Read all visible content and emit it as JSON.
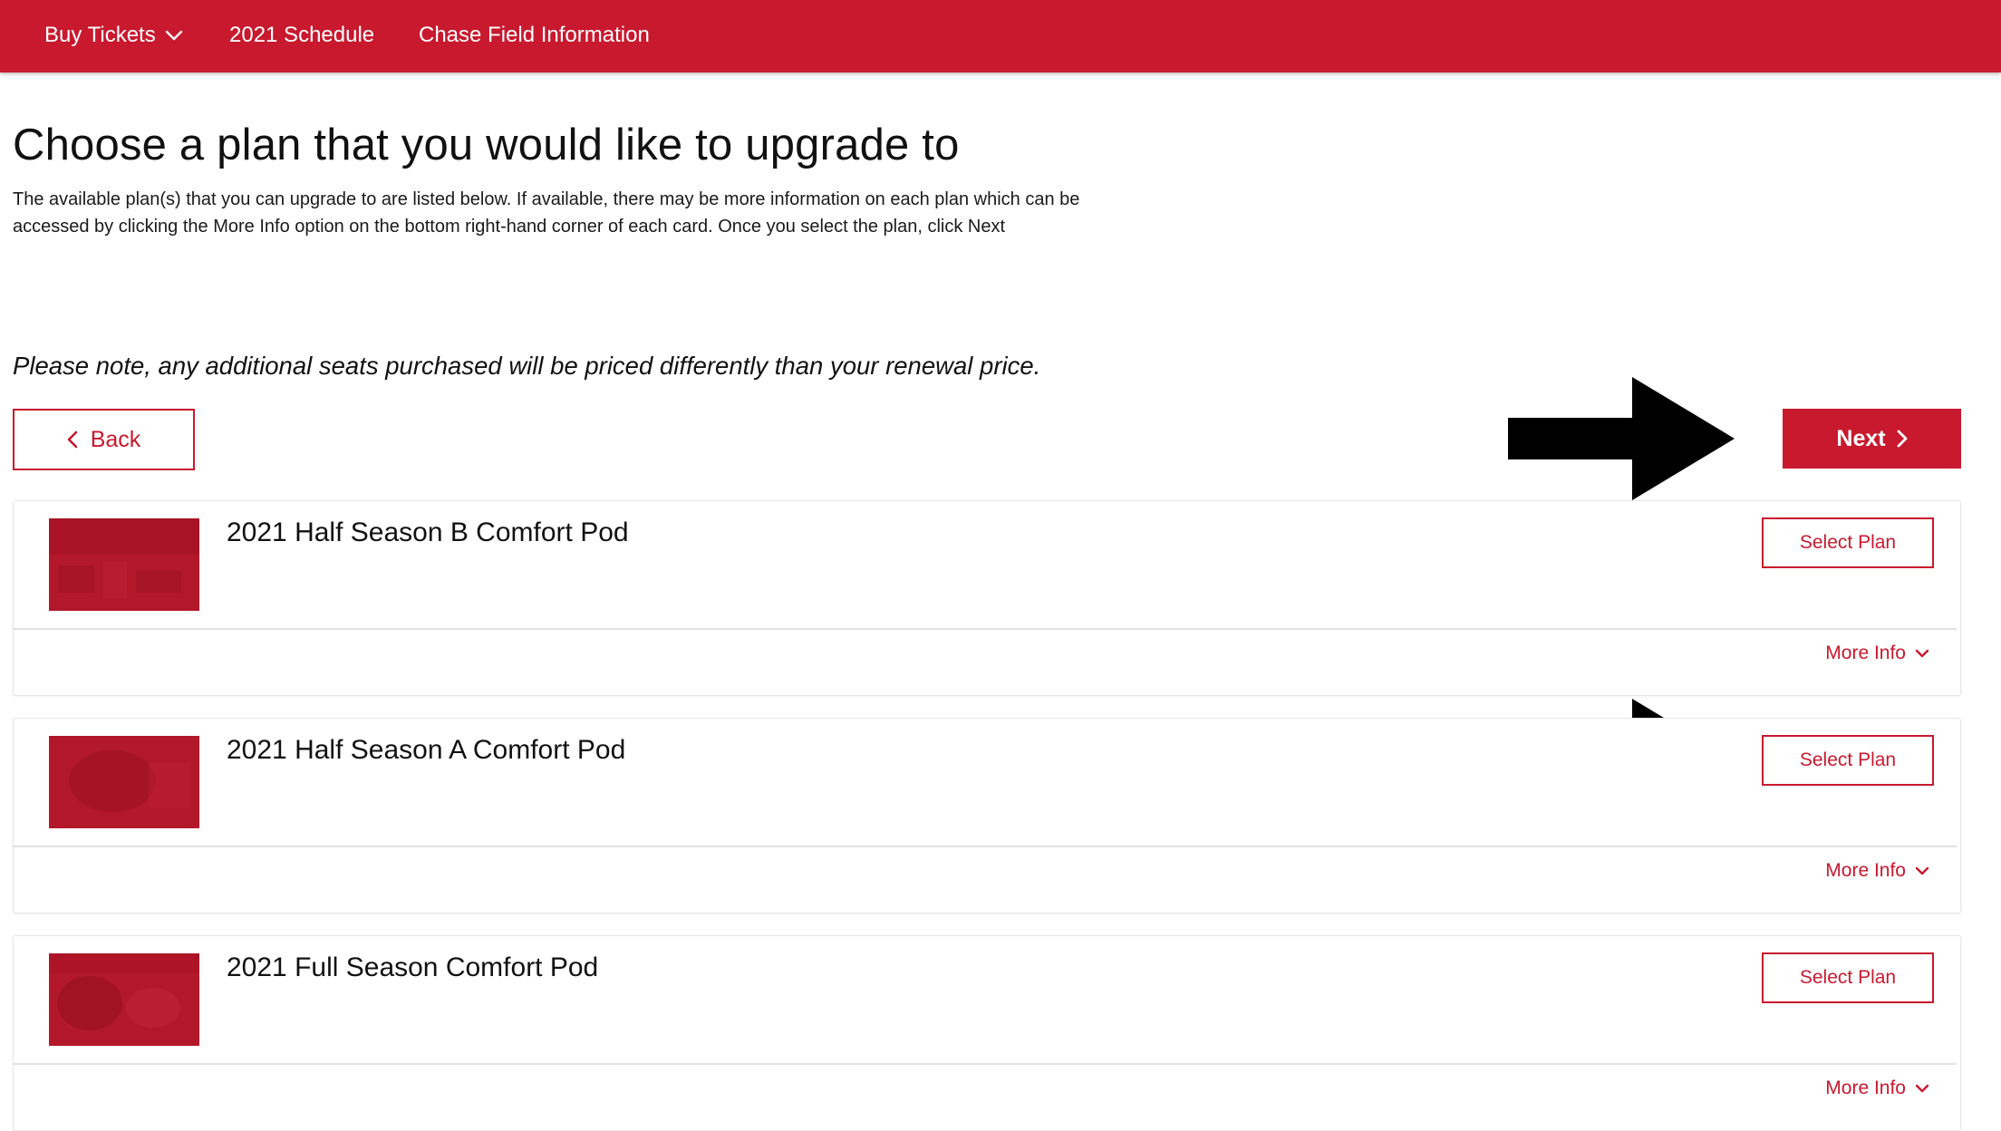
{
  "nav": {
    "items": [
      {
        "label": "Buy Tickets",
        "has_dropdown": true
      },
      {
        "label": "2021 Schedule",
        "has_dropdown": false
      },
      {
        "label": "Chase Field Information",
        "has_dropdown": false
      }
    ]
  },
  "header": {
    "title": "Choose a plan that you would like to upgrade to",
    "description": "The available plan(s) that you can upgrade to are listed below. If available, there may be more information on each plan which can be accessed by clicking the More Info option on the bottom right-hand corner of each card. Once you select the plan, click Next",
    "note": "Please note, any additional seats purchased will be priced differently than your renewal price."
  },
  "actions": {
    "back_label": "Back",
    "next_label": "Next"
  },
  "plans": [
    {
      "name": "2021 Half Season B Comfort Pod",
      "select_label": "Select Plan",
      "more_info_label": "More Info"
    },
    {
      "name": "2021 Half Season A Comfort Pod",
      "select_label": "Select Plan",
      "more_info_label": "More Info"
    },
    {
      "name": "2021 Full Season Comfort Pod",
      "select_label": "Select Plan",
      "more_info_label": "More Info"
    }
  ],
  "icons": {
    "dropdown": "chevron-down-icon",
    "back": "chevron-left-icon",
    "next": "chevron-right-icon",
    "annotation": "arrow-right-icon"
  },
  "colors": {
    "brand_red": "#c8192e",
    "thumbnail_red": "#b01527",
    "annotation_arrow": "#000000"
  }
}
